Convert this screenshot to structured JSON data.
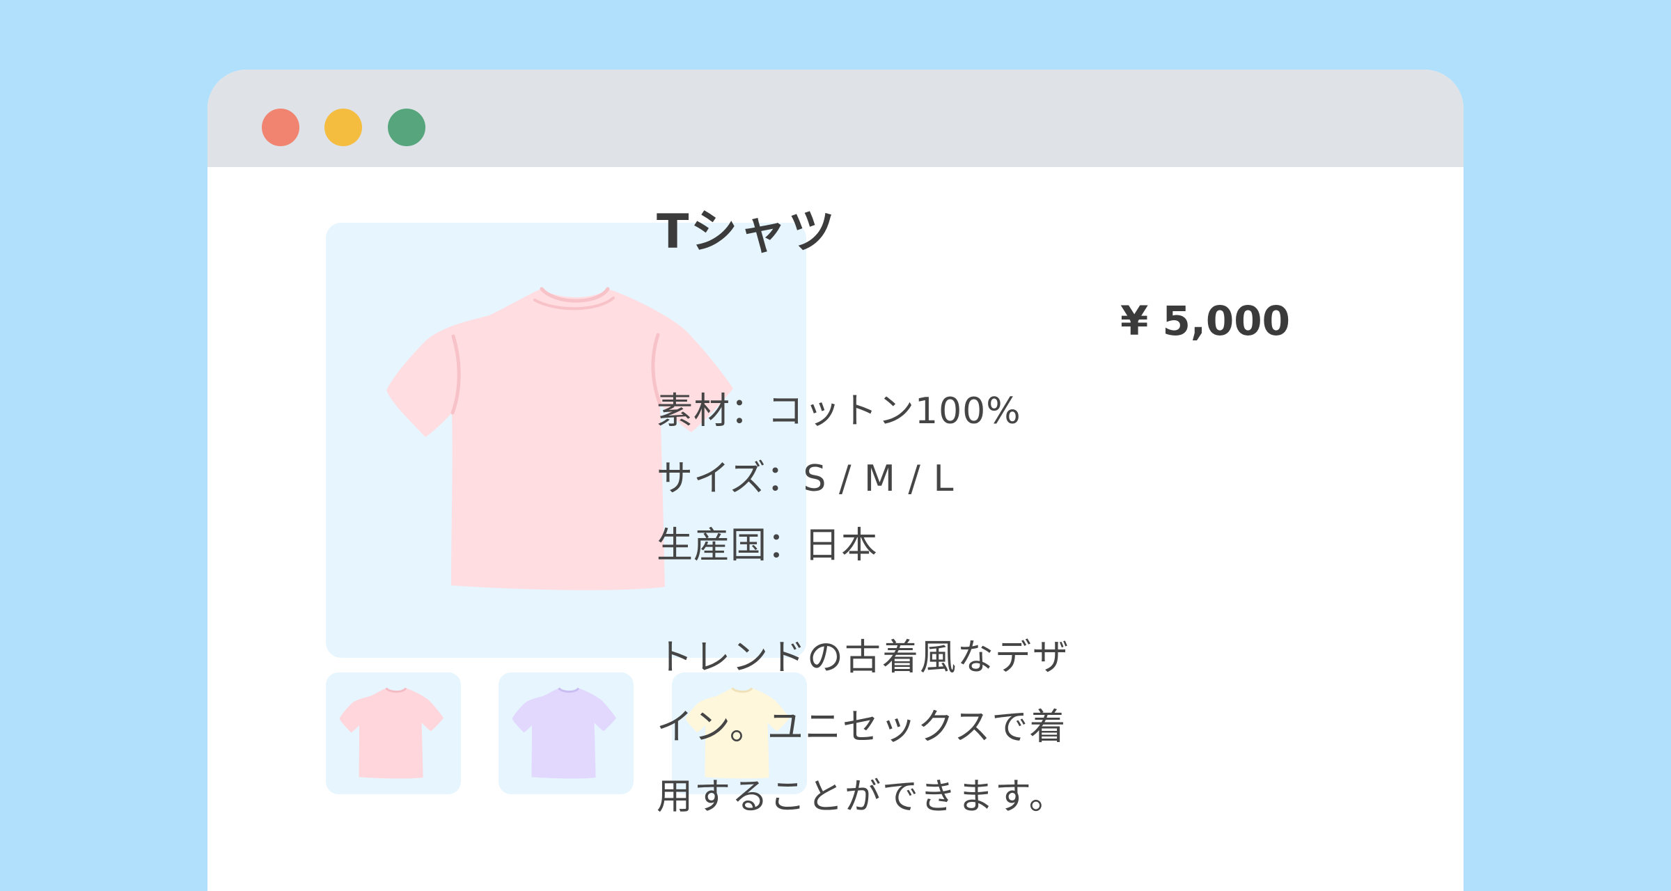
{
  "window": {
    "controls": [
      "close",
      "minimize",
      "maximize"
    ],
    "colors": {
      "close": "#f18470",
      "minimize": "#f5bd3f",
      "maximize": "#56a57d",
      "titlebar": "#dfe2e6"
    }
  },
  "product": {
    "title": "Tシャツ",
    "price": "¥ 5,000",
    "specs": [
      "素材：コットン100%",
      "サイズ：S / M / L",
      "生産国：日本"
    ],
    "description": "トレンドの古着風なデザイン。ユニセックスで着用することができます。"
  },
  "images": {
    "main": {
      "icon": "tshirt-icon",
      "color": "#ffdde1"
    },
    "thumbnails": [
      {
        "icon": "tshirt-icon",
        "color": "#ffd6dc"
      },
      {
        "icon": "tshirt-icon",
        "color": "#e2d8fe"
      },
      {
        "icon": "tshirt-icon",
        "color": "#fff7dc"
      }
    ]
  },
  "colors": {
    "background": "#b0e0fb",
    "image_bg": "#e6f5fe",
    "text": "#404040"
  }
}
